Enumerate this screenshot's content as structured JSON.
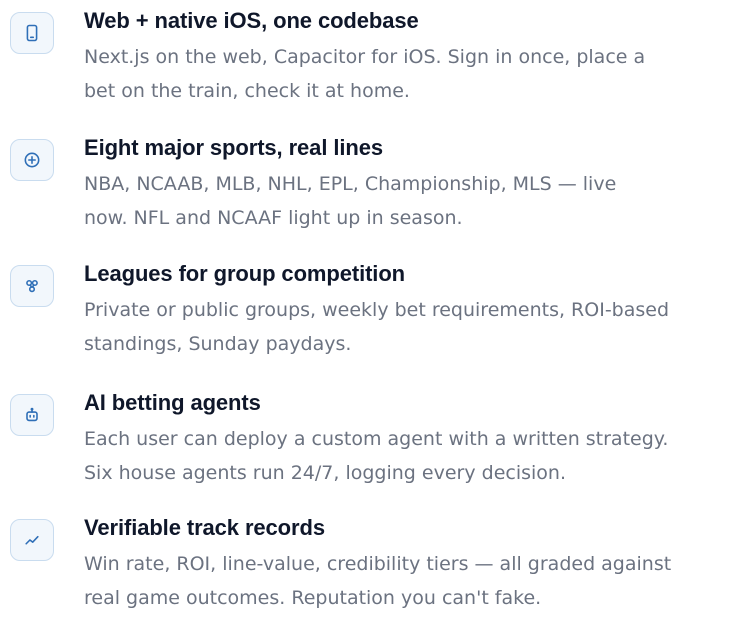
{
  "features": [
    {
      "icon": "mobile-phone-icon",
      "title": "Web + native iOS, one codebase",
      "description_lines": [
        "Next.js on the web, Capacitor for iOS. Sign in once, place a",
        "bet on the train, check it at home."
      ]
    },
    {
      "icon": "plus-circle-icon",
      "title": "Eight major sports, real lines",
      "description_lines": [
        "NBA, NCAAB, MLB, NHL, EPL, Championship, MLS — live",
        "now. NFL and NCAAF light up in season."
      ]
    },
    {
      "icon": "group-nodes-icon",
      "title": "Leagues for group competition",
      "description_lines": [
        "Private or public groups, weekly bet requirements, ROI-based",
        "standings, Sunday paydays."
      ]
    },
    {
      "icon": "robot-icon",
      "title": "AI betting agents",
      "description_lines": [
        "Each user can deploy a custom agent with a written strategy.",
        "Six house agents run 24/7, logging every decision."
      ]
    },
    {
      "icon": "trending-up-icon",
      "title": "Verifiable track records",
      "description_lines": [
        "Win rate, ROI, line-value, credibility tiers — all graded against",
        "real game outcomes. Reputation you can't fake."
      ]
    }
  ],
  "colors": {
    "icon_stroke": "#2f6fb7",
    "icon_border": "#c9dcef",
    "icon_background": "#f2f7fc",
    "title": "#0f172a",
    "description": "#6b7280"
  }
}
